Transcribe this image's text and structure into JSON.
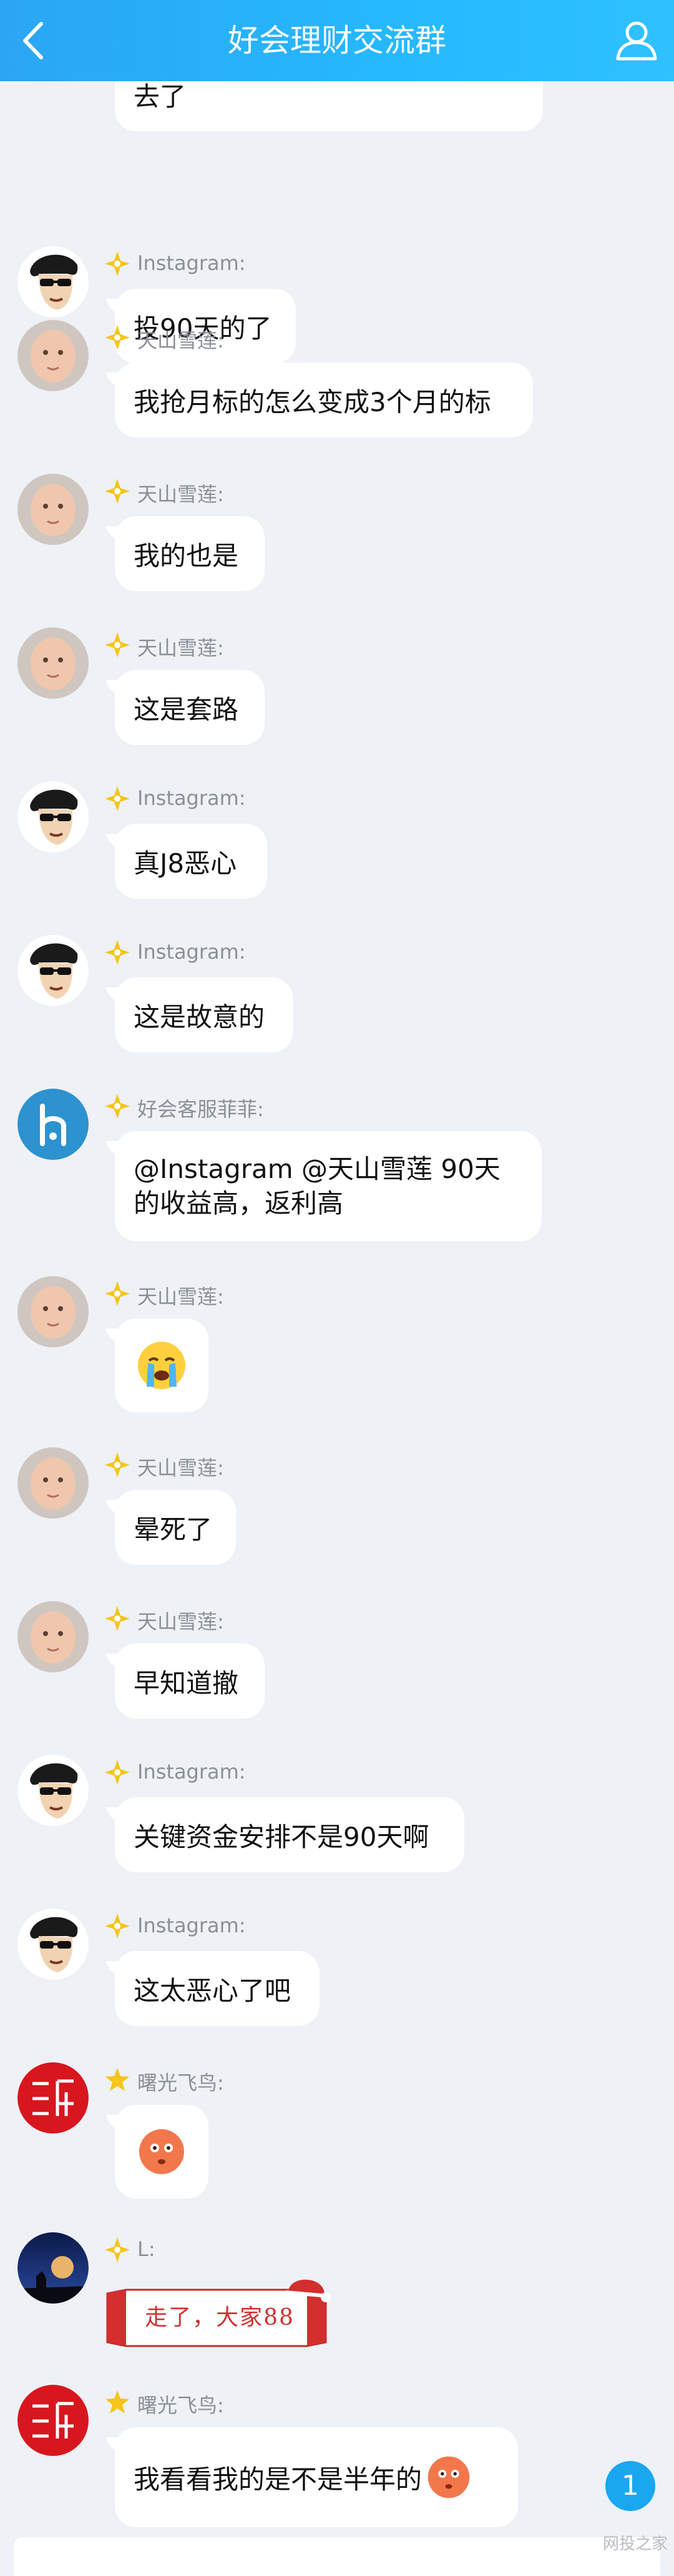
{
  "header": {
    "title": "好会理财交流群"
  },
  "colors": {
    "header_start": "#2ba6f5",
    "header_end": "#2fc1ff",
    "background": "#eef1f6",
    "badge": "#19a7f0"
  },
  "top_partial_message": {
    "text": "去了"
  },
  "messages": [
    {
      "sender": "Instagram:",
      "text": "投90天的了",
      "avatar": "comic-man-sunglasses"
    },
    {
      "sender": "天山雪莲:",
      "text": "我抢月标的怎么变成3个月的标",
      "avatar": "baby-photo"
    },
    {
      "sender": "天山雪莲:",
      "text": "我的也是",
      "avatar": "baby-photo"
    },
    {
      "sender": "天山雪莲:",
      "text": "这是套路",
      "avatar": "baby-photo"
    },
    {
      "sender": "Instagram:",
      "text": "真J8恶心",
      "avatar": "comic-man-sunglasses"
    },
    {
      "sender": "Instagram:",
      "text": "这是故意的",
      "avatar": "comic-man-sunglasses"
    },
    {
      "sender": "好会客服菲菲:",
      "text": "@Instagram @天山雪莲 90天的收益高，返利高",
      "avatar": "brand-h-logo"
    },
    {
      "sender": "天山雪莲:",
      "emoji": "crying-face-emoji",
      "avatar": "baby-photo"
    },
    {
      "sender": "天山雪莲:",
      "text": "晕死了",
      "avatar": "baby-photo"
    },
    {
      "sender": "天山雪莲:",
      "text": "早知道撤",
      "avatar": "baby-photo"
    },
    {
      "sender": "Instagram:",
      "text": "关键资金安排不是90天啊",
      "avatar": "comic-man-sunglasses"
    },
    {
      "sender": "Instagram:",
      "text": "这太恶心了吧",
      "avatar": "comic-man-sunglasses"
    },
    {
      "sender": "曙光飞鸟:",
      "emoji": "flushed-face-emoji",
      "avatar": "red-calligraphy-seal"
    },
    {
      "sender": "L:",
      "sticker_text": "走了，大家88",
      "avatar": "night-silhouette"
    },
    {
      "sender": "曙光飞鸟:",
      "text": "我看看我的是不是半年的",
      "emoji": "flushed-face-emoji",
      "avatar": "red-calligraphy-seal"
    }
  ],
  "unread_badge": "1",
  "watermark": "网投之家"
}
